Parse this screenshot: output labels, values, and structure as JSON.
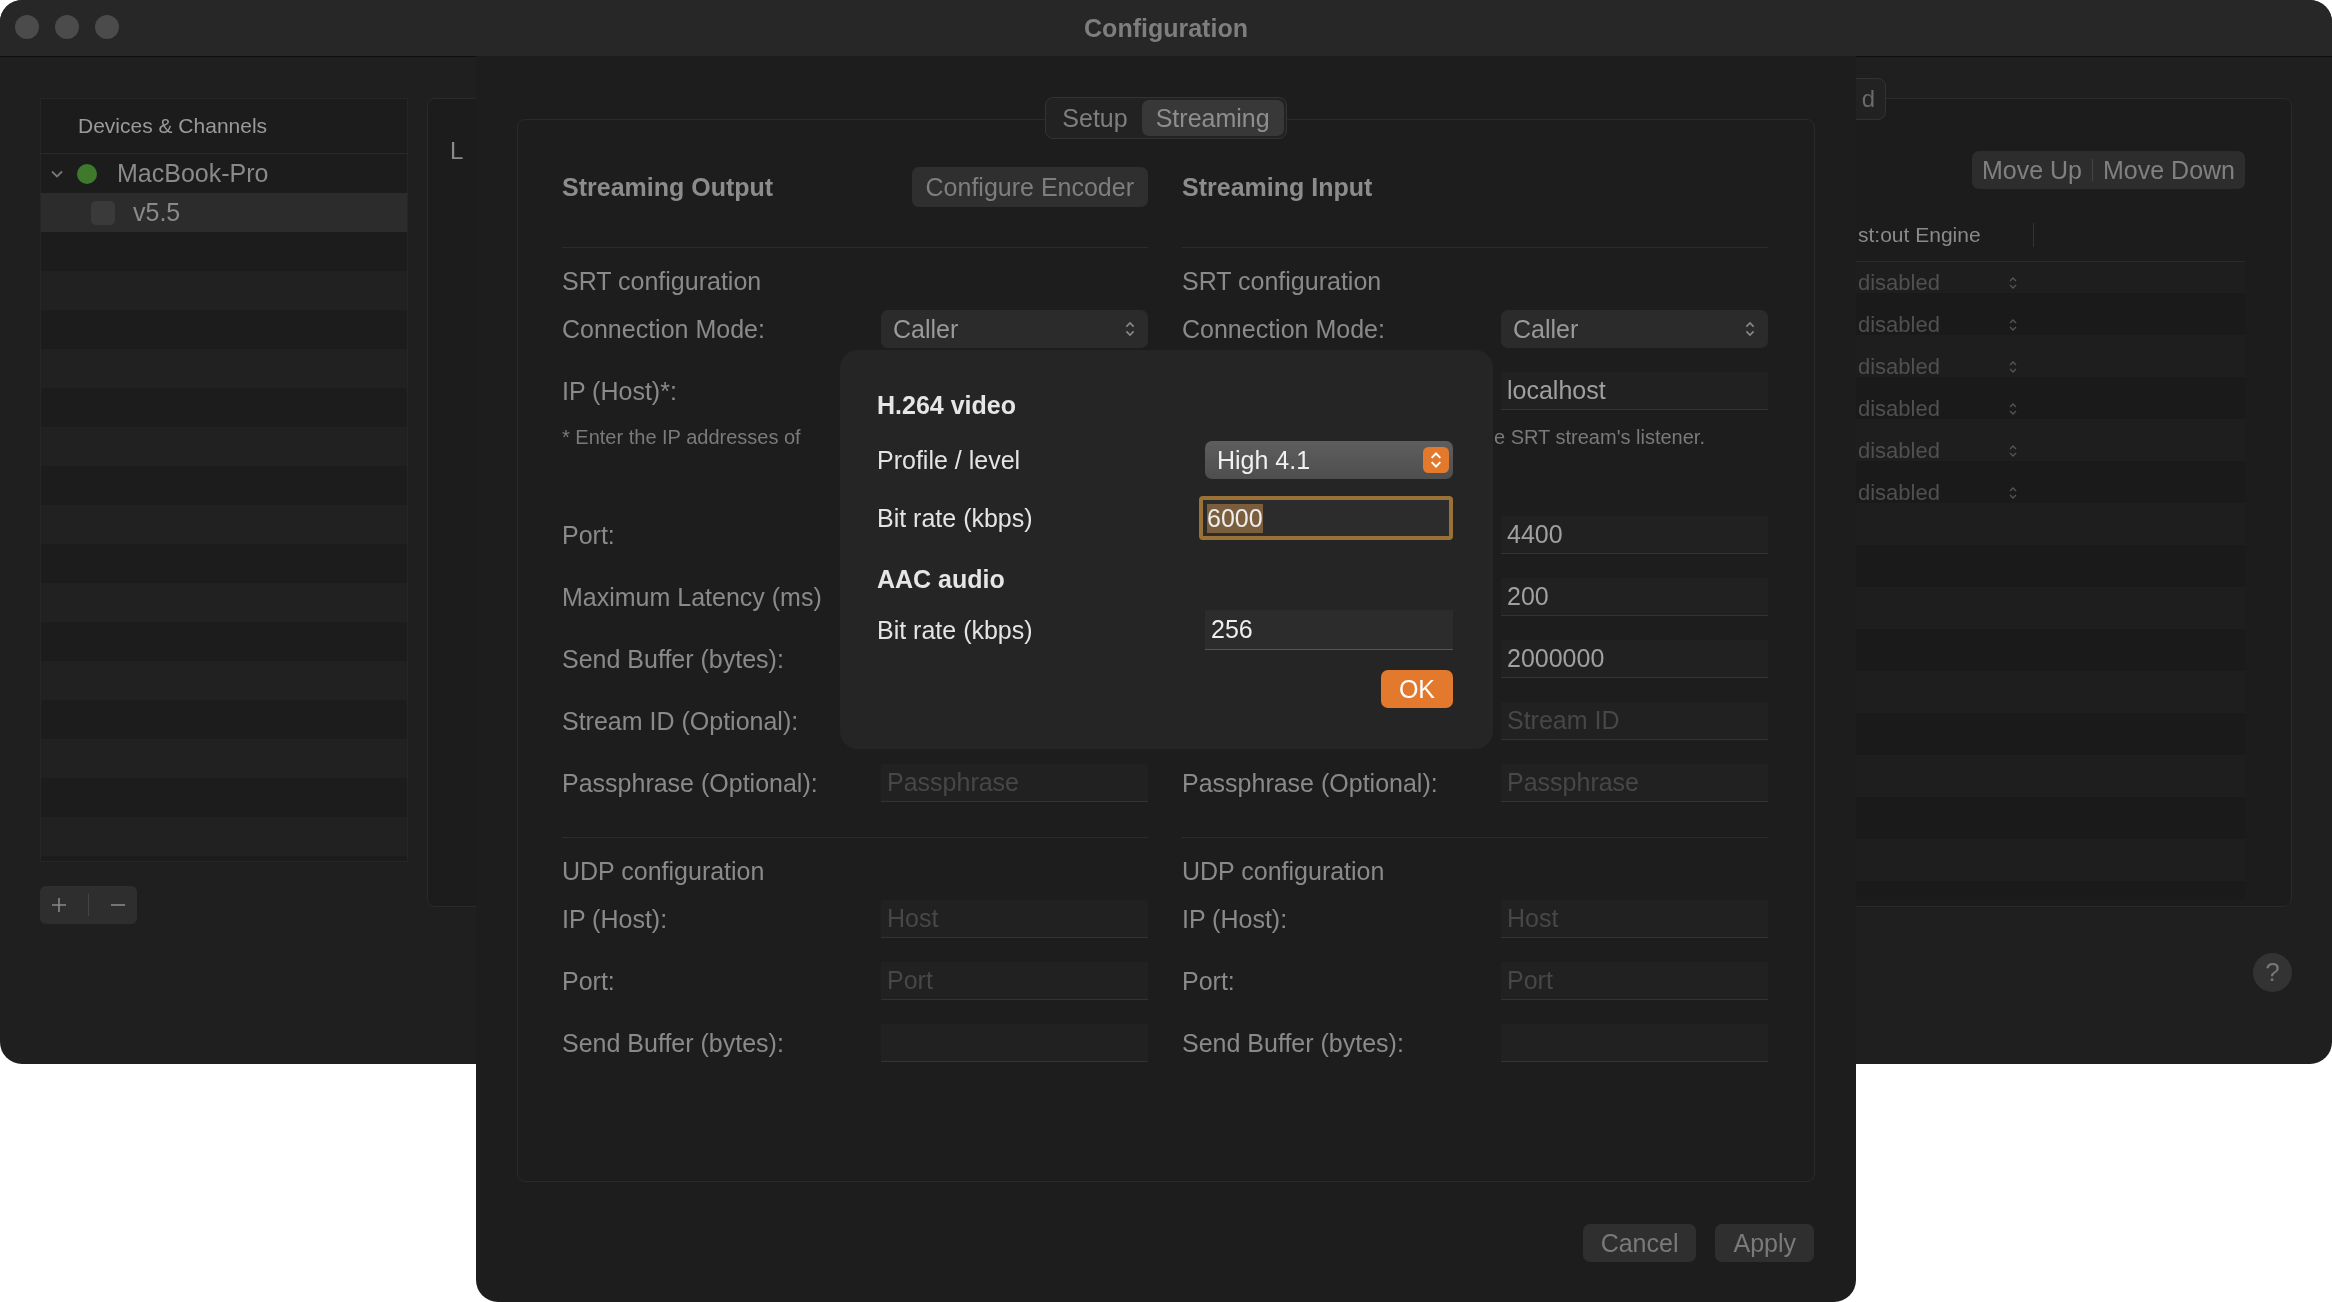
{
  "window": {
    "title": "Configuration"
  },
  "sidebar": {
    "header": "Devices & Channels",
    "items": [
      {
        "label": "MacBook-Pro",
        "expanded": true,
        "selected": false,
        "color": "#3f7a2c",
        "children": [
          {
            "label": "v5.5",
            "checked": false,
            "selected": true
          }
        ]
      }
    ]
  },
  "help": "?",
  "back_panel": {
    "label": "L",
    "tab": "d",
    "actions": [
      "Move Up",
      "Move Down"
    ],
    "table": {
      "columns": [
        "st:out Engine"
      ],
      "rows": [
        {
          "cells": [
            "disabled"
          ]
        },
        {
          "cells": [
            "disabled"
          ]
        },
        {
          "cells": [
            "disabled"
          ]
        },
        {
          "cells": [
            "disabled"
          ]
        },
        {
          "cells": [
            "disabled"
          ]
        },
        {
          "cells": [
            "disabled"
          ]
        }
      ]
    }
  },
  "sheet": {
    "tabs": [
      {
        "label": "Setup",
        "selected": false
      },
      {
        "label": "Streaming",
        "selected": true
      }
    ],
    "columns": [
      {
        "title": "Streaming Output",
        "button": "Configure Encoder",
        "sections": [
          {
            "title": "SRT configuration",
            "rows": [
              {
                "kind": "field",
                "label": "Connection Mode:",
                "field": {
                  "kind": "select",
                  "value": "Caller"
                }
              },
              {
                "kind": "field",
                "label": "IP (Host)*:"
              },
              {
                "kind": "note",
                "text": "* Enter the IP addresses of"
              },
              {
                "kind": "field",
                "label": "Port:"
              },
              {
                "kind": "field",
                "label": "Maximum Latency (ms)"
              },
              {
                "kind": "field",
                "label": "Send Buffer (bytes):"
              },
              {
                "kind": "field",
                "label": "Stream ID (Optional):"
              },
              {
                "kind": "field",
                "label": "Passphrase (Optional):",
                "field": {
                  "kind": "text",
                  "placeholder": "Passphrase"
                }
              }
            ]
          },
          {
            "title": "UDP configuration",
            "rows": [
              {
                "kind": "field",
                "label": "IP (Host):",
                "field": {
                  "kind": "text",
                  "placeholder": "Host"
                }
              },
              {
                "kind": "field",
                "label": "Port:",
                "field": {
                  "kind": "text",
                  "placeholder": "Port"
                }
              },
              {
                "kind": "field",
                "label": "Send Buffer (bytes):",
                "field": {
                  "kind": "text"
                }
              }
            ]
          }
        ]
      },
      {
        "title": "Streaming Input",
        "sections": [
          {
            "title": "SRT configuration",
            "rows": [
              {
                "kind": "field",
                "label": "Connection Mode:",
                "field": {
                  "kind": "select",
                  "value": "Caller"
                }
              },
              {
                "kind": "field",
                "field": {
                  "kind": "text",
                  "value": "localhost"
                }
              },
              {
                "kind": "note",
                "text": "e SRT stream's listener."
              },
              {
                "kind": "field",
                "field": {
                  "kind": "text",
                  "value": "4400"
                }
              },
              {
                "kind": "field",
                "field": {
                  "kind": "text",
                  "value": "200"
                }
              },
              {
                "kind": "field",
                "field": {
                  "kind": "text",
                  "value": "2000000"
                }
              },
              {
                "kind": "field",
                "field": {
                  "kind": "text",
                  "placeholder": "Stream ID"
                }
              },
              {
                "kind": "field",
                "label": "Passphrase (Optional):",
                "field": {
                  "kind": "text",
                  "placeholder": "Passphrase"
                }
              }
            ]
          },
          {
            "title": "UDP configuration",
            "rows": [
              {
                "kind": "field",
                "label": "IP (Host):",
                "field": {
                  "kind": "text",
                  "placeholder": "Host"
                }
              },
              {
                "kind": "field",
                "label": "Port:",
                "field": {
                  "kind": "text",
                  "placeholder": "Port"
                }
              },
              {
                "kind": "field",
                "label": "Send Buffer (bytes):",
                "field": {
                  "kind": "text"
                }
              }
            ]
          }
        ]
      }
    ],
    "buttons": [
      "Cancel",
      "Apply"
    ]
  },
  "encoder_dialog": {
    "sections": [
      {
        "title": "H.264 video",
        "rows": [
          {
            "label": "Profile / level",
            "kind": "select",
            "value": "High 4.1"
          },
          {
            "label": "Bit rate (kbps)",
            "kind": "text",
            "value": "6000",
            "focused": true
          }
        ]
      },
      {
        "title": "AAC audio",
        "rows": [
          {
            "label": "Bit rate (kbps)",
            "kind": "text",
            "value": "256",
            "focused": false
          }
        ]
      }
    ],
    "ok": "OK"
  }
}
